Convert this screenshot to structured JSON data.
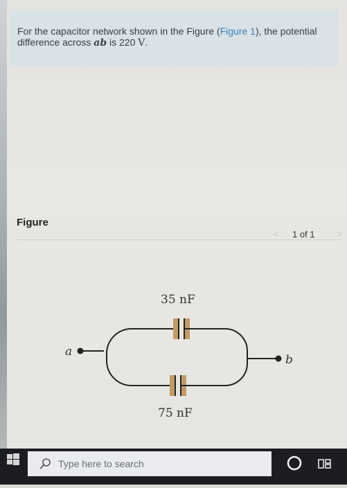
{
  "question": {
    "text_before": "For the capacitor network shown in the Figure (",
    "figure_link": "Figure 1",
    "text_mid": "), the potential difference across ",
    "math_ab": "ab",
    "text_is": " is 220 ",
    "unit": "V",
    "text_end": "."
  },
  "figure": {
    "heading": "Figure",
    "pager": {
      "prev": "<",
      "count": "1 of 1",
      "next": ">"
    },
    "circuit": {
      "top_capacitor_label": "35 nF",
      "bottom_capacitor_label": "75 nF",
      "node_a": "a",
      "node_b": "b",
      "capacitor_plate_color": "#c49a63"
    }
  },
  "taskbar": {
    "search_placeholder": "Type here to search",
    "start_icon": "windows-logo-icon",
    "cortana_icon": "cortana-circle-icon",
    "task_view_icon": "task-view-icon"
  }
}
